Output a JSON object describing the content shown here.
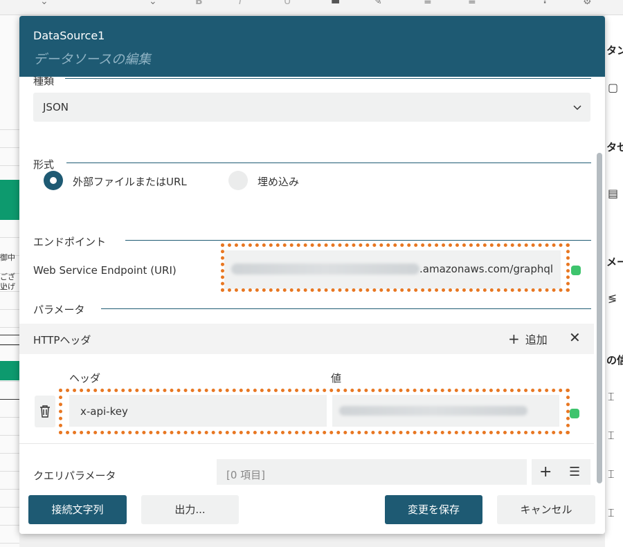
{
  "background": {
    "right_panel_fragments": [
      "タン",
      "タセ",
      "メー",
      "の信"
    ],
    "left_panel_fragments": [
      "御中",
      "ござい",
      "上げ"
    ]
  },
  "dialog": {
    "title": "DataSource1",
    "subtitle": "データソースの編集",
    "sections": {
      "type_label": "種類",
      "type_value": "JSON",
      "format_label": "形式",
      "format_options": [
        "外部ファイルまたはURL",
        "埋め込み"
      ],
      "format_selected": 0,
      "endpoint_label": "エンドポイント",
      "endpoint_field_label": "Web Service Endpoint (URI)",
      "endpoint_value_visible": ".amazonaws.com/graphql",
      "params_label": "パラメータ",
      "http_header_label": "HTTPヘッダ",
      "add_label": "追加",
      "col_header": "ヘッダ",
      "col_value": "値",
      "header_key": "x-api-key",
      "query_params_label": "クエリパラメータ",
      "query_params_value": "[0 項目]"
    },
    "footer": {
      "connection_string": "接続文字列",
      "output": "出力...",
      "save": "変更を保存",
      "cancel": "キャンセル"
    }
  },
  "colors": {
    "primary": "#1e5a73",
    "highlight": "#e87722",
    "status": "#3ec46d"
  }
}
